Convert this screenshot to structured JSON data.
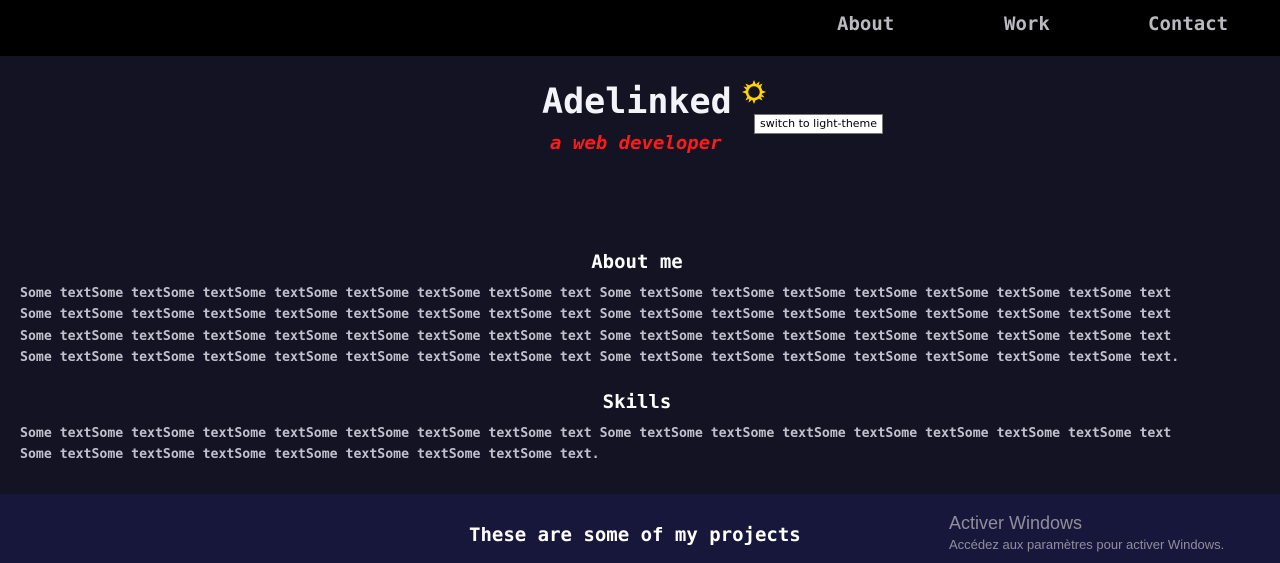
{
  "nav": {
    "items": [
      {
        "label": "About"
      },
      {
        "label": "Work"
      },
      {
        "label": "Contact"
      }
    ]
  },
  "hero": {
    "title": "Adelinked",
    "subtitle": "a web developer",
    "theme_toggle_icon": "sun-icon",
    "theme_toggle_tooltip": "switch to light-theme"
  },
  "about": {
    "heading": "About me",
    "lines": [
      "Some textSome textSome textSome textSome textSome textSome textSome text Some textSome textSome textSome textSome textSome textSome textSome text",
      "Some textSome textSome textSome textSome textSome textSome textSome text Some textSome textSome textSome textSome textSome textSome textSome text",
      "Some textSome textSome textSome textSome textSome textSome textSome text Some textSome textSome textSome textSome textSome textSome textSome text",
      "Some textSome textSome textSome textSome textSome textSome textSome text Some textSome textSome textSome textSome textSome textSome textSome text."
    ]
  },
  "skills": {
    "heading": "Skills",
    "lines": [
      "Some textSome textSome textSome textSome textSome textSome textSome text Some textSome textSome textSome textSome textSome textSome textSome text",
      "Some textSome textSome textSome textSome textSome textSome textSome text."
    ]
  },
  "projects": {
    "heading": "These are some of my projects"
  },
  "watermark": {
    "title": "Activer Windows",
    "subtitle": "Accédez aux paramètres pour activer Windows."
  },
  "colors": {
    "navbar_bg": "#000000",
    "page_bg": "#131324",
    "projects_bg": "#17173b",
    "subtitle": "#ff1a1a",
    "sun": "#ffd400"
  }
}
